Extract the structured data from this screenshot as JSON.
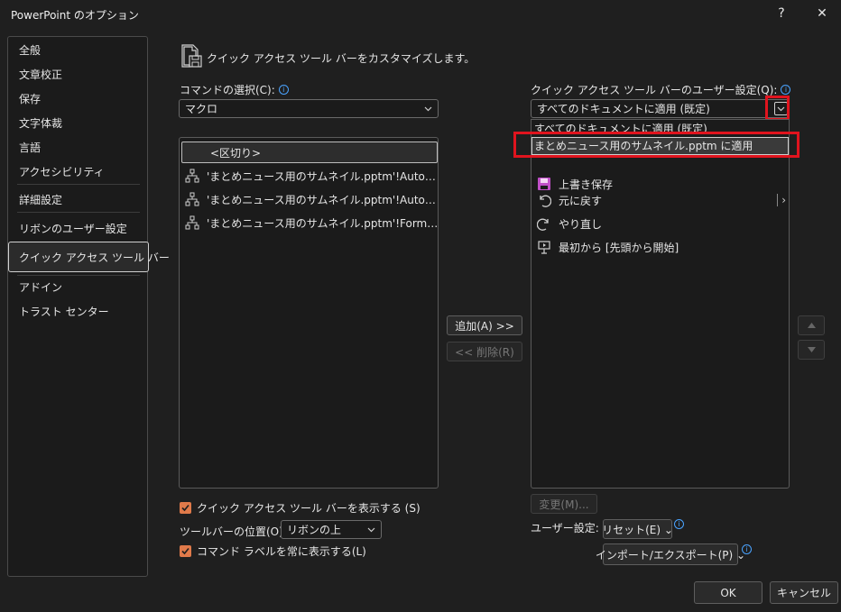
{
  "window": {
    "title": "PowerPoint のオプション",
    "help": "?",
    "close": "✕"
  },
  "sidebar": {
    "items": [
      "全般",
      "文章校正",
      "保存",
      "文字体裁",
      "言語",
      "アクセシビリティ",
      "詳細設定",
      "リボンのユーザー設定",
      "クイック アクセス ツール バー",
      "アドイン",
      "トラスト センター"
    ],
    "selected_index": 8
  },
  "header": {
    "text": "クイック アクセス ツール バーをカスタマイズします。"
  },
  "left": {
    "command_label": "コマンドの選択(C):",
    "command_value": "マクロ",
    "items": [
      "<区切り>",
      "'まとめニュース用のサムネイル.pptm'!Auto…",
      "'まとめニュース用のサムネイル.pptm'!Auto…",
      "'まとめニュース用のサムネイル.pptm'!Form…"
    ],
    "show_qat_label": "クイック アクセス ツール バーを表示する (S)",
    "position_label": "ツールバーの位置(O)",
    "position_value": "リボンの上",
    "show_labels_label": "コマンド ラベルを常に表示する(L)"
  },
  "middle": {
    "add": "追加(A) >>",
    "remove": "<< 削除(R)"
  },
  "right": {
    "qat_label": "クイック アクセス ツール バーのユーザー設定(Q):",
    "qat_value": "すべてのドキュメントに適用 (既定)",
    "dropdown_options": [
      "すべてのドキュメントに適用 (既定)",
      "まとめニュース用のサムネイル.pptm に適用"
    ],
    "items": [
      "上書き保存",
      "元に戻す",
      "やり直し",
      "最初から [先頭から開始]"
    ],
    "modify": "変更(M)...",
    "user_settings_label": "ユーザー設定:",
    "reset": "リセット(E) ⌄",
    "import_export": "インポート/エクスポート(P) ⌄"
  },
  "footer": {
    "ok": "OK",
    "cancel": "キャンセル"
  },
  "colors": {
    "accent_check": "#e07a4a",
    "highlight_red": "#e0141e",
    "info_blue": "#4aa3ff",
    "save_icon": "#c050c8"
  }
}
